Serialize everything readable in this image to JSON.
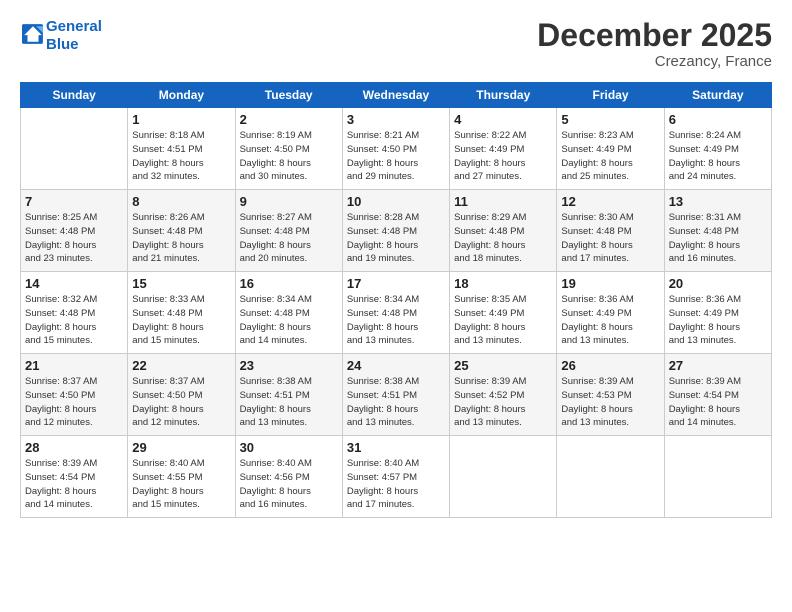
{
  "header": {
    "logo_line1": "General",
    "logo_line2": "Blue",
    "month": "December 2025",
    "location": "Crezancy, France"
  },
  "weekdays": [
    "Sunday",
    "Monday",
    "Tuesday",
    "Wednesday",
    "Thursday",
    "Friday",
    "Saturday"
  ],
  "weeks": [
    [
      {
        "day": "",
        "info": ""
      },
      {
        "day": "1",
        "info": "Sunrise: 8:18 AM\nSunset: 4:51 PM\nDaylight: 8 hours\nand 32 minutes."
      },
      {
        "day": "2",
        "info": "Sunrise: 8:19 AM\nSunset: 4:50 PM\nDaylight: 8 hours\nand 30 minutes."
      },
      {
        "day": "3",
        "info": "Sunrise: 8:21 AM\nSunset: 4:50 PM\nDaylight: 8 hours\nand 29 minutes."
      },
      {
        "day": "4",
        "info": "Sunrise: 8:22 AM\nSunset: 4:49 PM\nDaylight: 8 hours\nand 27 minutes."
      },
      {
        "day": "5",
        "info": "Sunrise: 8:23 AM\nSunset: 4:49 PM\nDaylight: 8 hours\nand 25 minutes."
      },
      {
        "day": "6",
        "info": "Sunrise: 8:24 AM\nSunset: 4:49 PM\nDaylight: 8 hours\nand 24 minutes."
      }
    ],
    [
      {
        "day": "7",
        "info": "Sunrise: 8:25 AM\nSunset: 4:48 PM\nDaylight: 8 hours\nand 23 minutes."
      },
      {
        "day": "8",
        "info": "Sunrise: 8:26 AM\nSunset: 4:48 PM\nDaylight: 8 hours\nand 21 minutes."
      },
      {
        "day": "9",
        "info": "Sunrise: 8:27 AM\nSunset: 4:48 PM\nDaylight: 8 hours\nand 20 minutes."
      },
      {
        "day": "10",
        "info": "Sunrise: 8:28 AM\nSunset: 4:48 PM\nDaylight: 8 hours\nand 19 minutes."
      },
      {
        "day": "11",
        "info": "Sunrise: 8:29 AM\nSunset: 4:48 PM\nDaylight: 8 hours\nand 18 minutes."
      },
      {
        "day": "12",
        "info": "Sunrise: 8:30 AM\nSunset: 4:48 PM\nDaylight: 8 hours\nand 17 minutes."
      },
      {
        "day": "13",
        "info": "Sunrise: 8:31 AM\nSunset: 4:48 PM\nDaylight: 8 hours\nand 16 minutes."
      }
    ],
    [
      {
        "day": "14",
        "info": "Sunrise: 8:32 AM\nSunset: 4:48 PM\nDaylight: 8 hours\nand 15 minutes."
      },
      {
        "day": "15",
        "info": "Sunrise: 8:33 AM\nSunset: 4:48 PM\nDaylight: 8 hours\nand 15 minutes."
      },
      {
        "day": "16",
        "info": "Sunrise: 8:34 AM\nSunset: 4:48 PM\nDaylight: 8 hours\nand 14 minutes."
      },
      {
        "day": "17",
        "info": "Sunrise: 8:34 AM\nSunset: 4:48 PM\nDaylight: 8 hours\nand 13 minutes."
      },
      {
        "day": "18",
        "info": "Sunrise: 8:35 AM\nSunset: 4:49 PM\nDaylight: 8 hours\nand 13 minutes."
      },
      {
        "day": "19",
        "info": "Sunrise: 8:36 AM\nSunset: 4:49 PM\nDaylight: 8 hours\nand 13 minutes."
      },
      {
        "day": "20",
        "info": "Sunrise: 8:36 AM\nSunset: 4:49 PM\nDaylight: 8 hours\nand 13 minutes."
      }
    ],
    [
      {
        "day": "21",
        "info": "Sunrise: 8:37 AM\nSunset: 4:50 PM\nDaylight: 8 hours\nand 12 minutes."
      },
      {
        "day": "22",
        "info": "Sunrise: 8:37 AM\nSunset: 4:50 PM\nDaylight: 8 hours\nand 12 minutes."
      },
      {
        "day": "23",
        "info": "Sunrise: 8:38 AM\nSunset: 4:51 PM\nDaylight: 8 hours\nand 13 minutes."
      },
      {
        "day": "24",
        "info": "Sunrise: 8:38 AM\nSunset: 4:51 PM\nDaylight: 8 hours\nand 13 minutes."
      },
      {
        "day": "25",
        "info": "Sunrise: 8:39 AM\nSunset: 4:52 PM\nDaylight: 8 hours\nand 13 minutes."
      },
      {
        "day": "26",
        "info": "Sunrise: 8:39 AM\nSunset: 4:53 PM\nDaylight: 8 hours\nand 13 minutes."
      },
      {
        "day": "27",
        "info": "Sunrise: 8:39 AM\nSunset: 4:54 PM\nDaylight: 8 hours\nand 14 minutes."
      }
    ],
    [
      {
        "day": "28",
        "info": "Sunrise: 8:39 AM\nSunset: 4:54 PM\nDaylight: 8 hours\nand 14 minutes."
      },
      {
        "day": "29",
        "info": "Sunrise: 8:40 AM\nSunset: 4:55 PM\nDaylight: 8 hours\nand 15 minutes."
      },
      {
        "day": "30",
        "info": "Sunrise: 8:40 AM\nSunset: 4:56 PM\nDaylight: 8 hours\nand 16 minutes."
      },
      {
        "day": "31",
        "info": "Sunrise: 8:40 AM\nSunset: 4:57 PM\nDaylight: 8 hours\nand 17 minutes."
      },
      {
        "day": "",
        "info": ""
      },
      {
        "day": "",
        "info": ""
      },
      {
        "day": "",
        "info": ""
      }
    ]
  ]
}
